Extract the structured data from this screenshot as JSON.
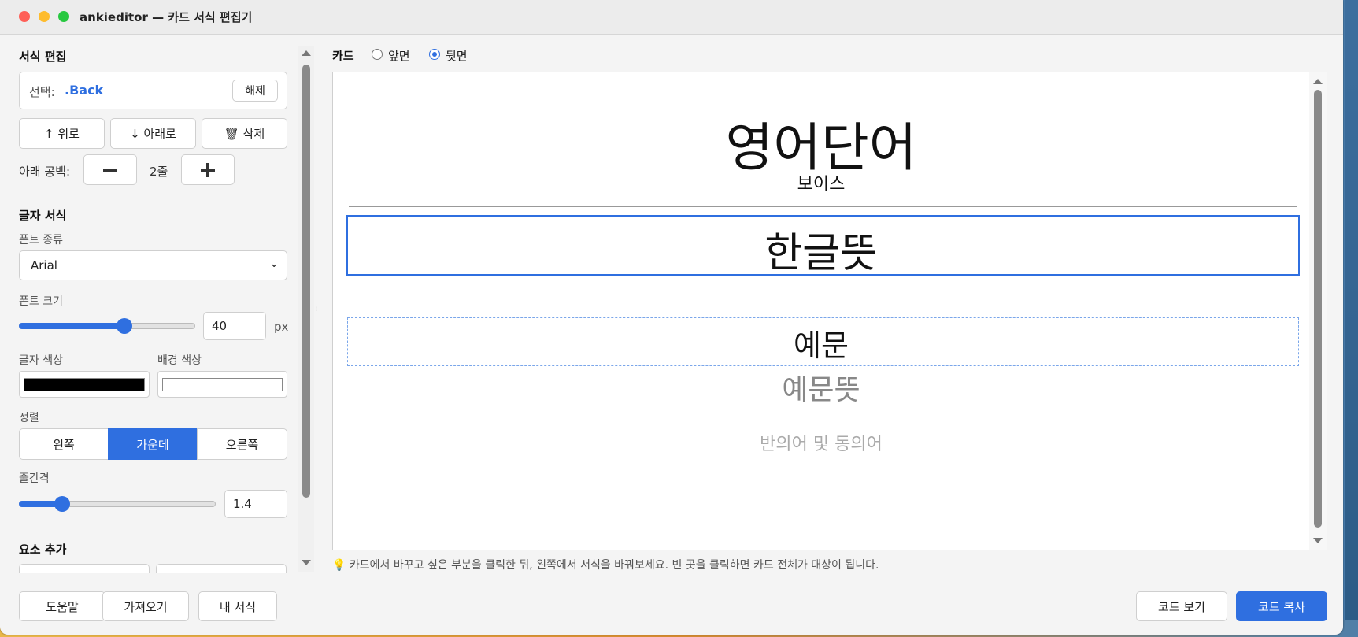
{
  "window": {
    "title": "ankieditor — 카드 서식 편집기"
  },
  "format_edit": {
    "title": "서식 편집",
    "selection_label": "선택:",
    "selection_value": ".Back",
    "clear_label": "해제",
    "up_label": "↑ 위로",
    "down_label": "↓ 아래로",
    "delete_label": "🗑 삭제",
    "bottom_space_label": "아래 공백:",
    "bottom_space_value": "2줄"
  },
  "text_format": {
    "title": "글자 서식",
    "font_family_label": "폰트 종류",
    "font_family_value": "Arial",
    "font_size_label": "폰트 크기",
    "font_size_value": "40",
    "font_size_unit": "px",
    "font_size_slider_fraction": 0.6,
    "text_color_label": "글자 색상",
    "text_color": "#000000",
    "bg_color_label": "배경 색상",
    "bg_color": "#ffffff",
    "align_label": "정렬",
    "align_options": [
      "왼쪽",
      "가운데",
      "오른쪽"
    ],
    "align_selected": "가운데",
    "line_height_label": "줄간격",
    "line_height_value": "1.4",
    "line_height_slider_fraction": 0.22
  },
  "add_element": {
    "title": "요소 추가"
  },
  "card_view": {
    "label": "카드",
    "front_label": "앞면",
    "back_label": "뒷면",
    "selected_side": "뒷면",
    "lines": {
      "word": "영어단어",
      "voice": "보이스",
      "meaning": "한글뜻",
      "example": "예문",
      "example_meaning": "예문뜻",
      "synonyms": "반의어 및 동의어"
    },
    "hint": "카드에서 바꾸고 싶은 부분을 클릭한 뒤, 왼쪽에서 서식을 바꿔보세요. 빈 곳을 클릭하면 카드 전체가 대상이 됩니다."
  },
  "footer": {
    "help": "도움말",
    "import": "가져오기",
    "my_format": "내 서식",
    "view_code": "코드 보기",
    "copy_code": "코드 복사"
  },
  "colors": {
    "accent": "#2f6fe0",
    "muted_text": "#888888",
    "light_text": "#aaaaaa"
  }
}
